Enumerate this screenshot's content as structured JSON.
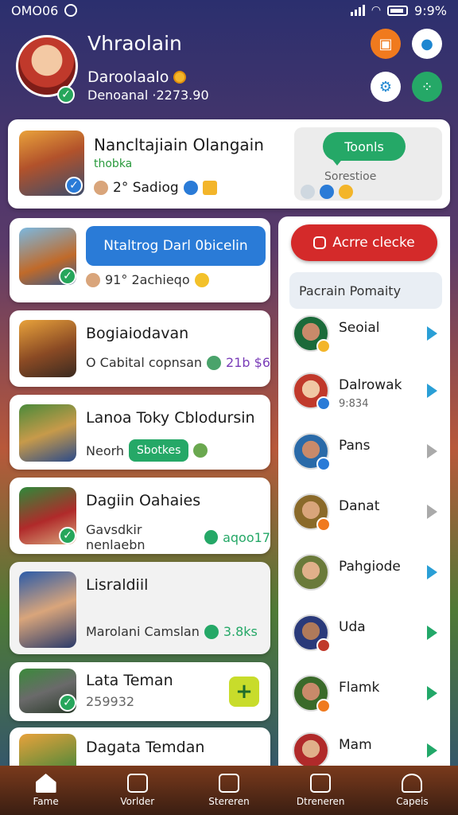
{
  "status": {
    "time": "OMO06",
    "battery": "9:9%"
  },
  "header": {
    "name": "Vhraolain",
    "sub1": "Daroolaalo",
    "sub2": "Denoanal ·2273.90"
  },
  "featured": {
    "title": "Nancltajiain Olangain",
    "sub": "thobka",
    "meta": "2° Sadiog",
    "side_pill": "Toonls",
    "side_text": "Sorestioe"
  },
  "cards": [
    {
      "bubble": "Ntaltrog Darl 0bicelin",
      "meta": "91° 2achieqo"
    },
    {
      "title": "Bogiaiodavan",
      "meta": "O Cabital copnsan",
      "stat": "21b $6"
    },
    {
      "title": "Lanoa Toky Cblodursin",
      "meta": "Neorh",
      "badge": "Sbotkes"
    },
    {
      "title": "Dagiin Oahaies",
      "meta": "Gavsdkir nenlaebn",
      "stat": "aqoo17"
    },
    {
      "title": "Lisraldiil",
      "meta": "Marolani Camslan",
      "stat": "3.8ks"
    },
    {
      "title": "Lata Teman",
      "meta": "259932"
    },
    {
      "title": "Dagata Temdan"
    }
  ],
  "right_panel": {
    "action": "Acrre clecke",
    "search": "Pacrain Pomaity",
    "friends": [
      {
        "name": "Seoial",
        "sub": ""
      },
      {
        "name": "Dalrowak",
        "sub": "9:834"
      },
      {
        "name": "Pans",
        "sub": ""
      },
      {
        "name": "Danat",
        "sub": ""
      },
      {
        "name": "Pahgiode",
        "sub": ""
      },
      {
        "name": "Uda",
        "sub": ""
      },
      {
        "name": "Flamk",
        "sub": ""
      },
      {
        "name": "Mam",
        "sub": ""
      }
    ]
  },
  "nav": [
    {
      "label": "Fame"
    },
    {
      "label": "Vorlder"
    },
    {
      "label": "Stereren"
    },
    {
      "label": "Dtreneren"
    },
    {
      "label": "Capeis"
    }
  ],
  "colors": {
    "accent_green": "#25a867",
    "accent_red": "#d42a2a",
    "accent_blue": "#2a7bd7"
  }
}
